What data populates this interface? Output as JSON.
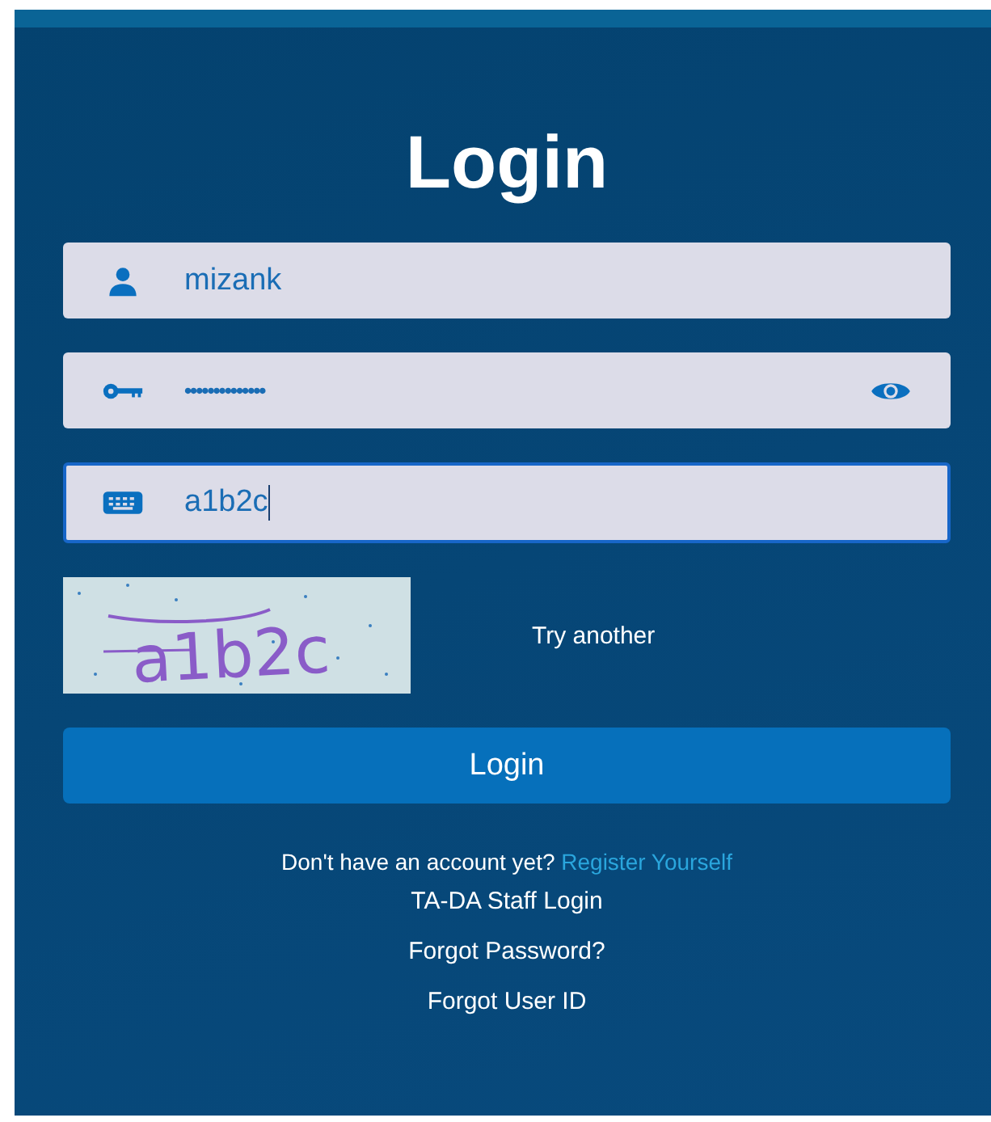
{
  "title": "Login",
  "fields": [
    {
      "kind": "user",
      "value": "mizank",
      "focused": false
    },
    {
      "kind": "password",
      "value": "••••••••••••••",
      "focused": false
    },
    {
      "kind": "captcha",
      "value": "a1b2c",
      "focused": true
    }
  ],
  "captcha": {
    "text": "a1b2c",
    "refresh_label": "Try another"
  },
  "login_button": "Login",
  "register": {
    "prompt": "Don't have an account yet?",
    "link": "Register Yourself"
  },
  "links": [
    "TA-DA Staff Login",
    "Forgot Password?",
    "Forgot User ID"
  ]
}
